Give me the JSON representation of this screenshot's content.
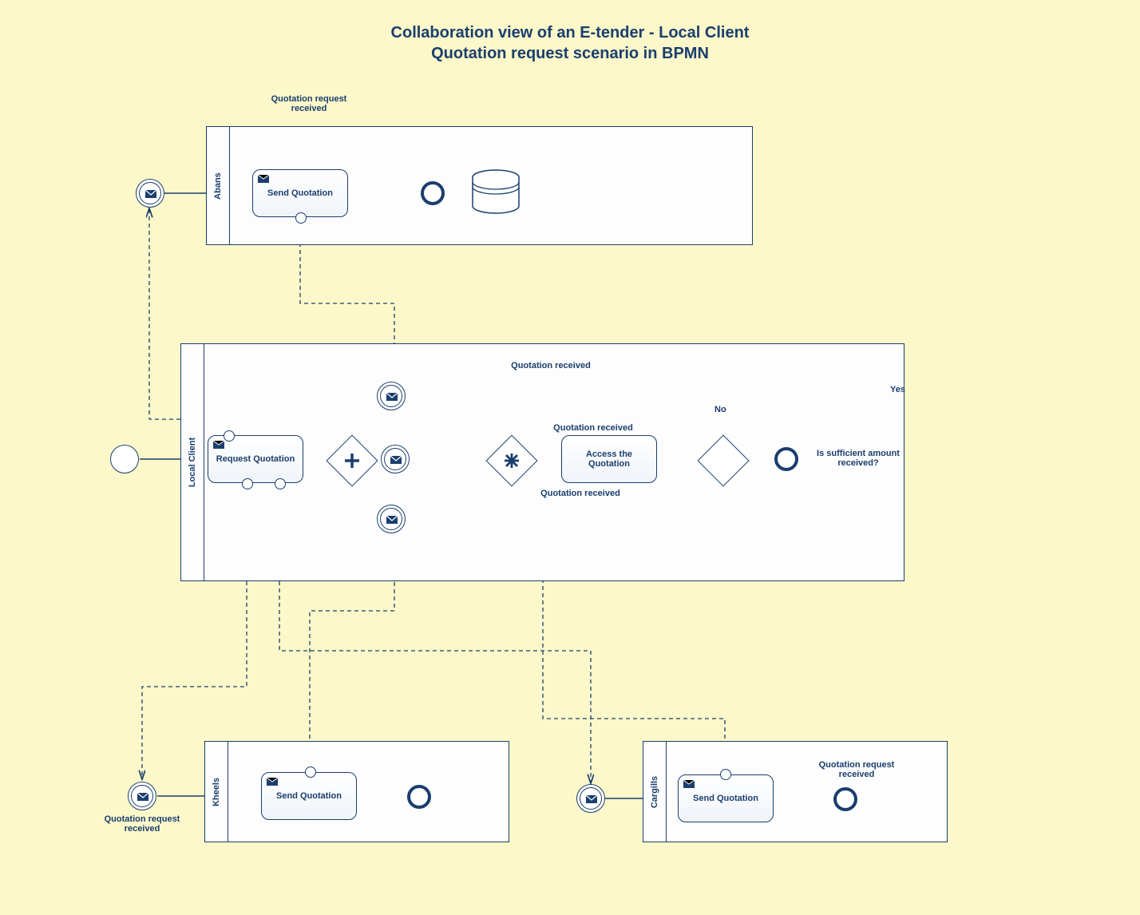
{
  "title_line1": "Collaboration view of an E-tender - Local Client",
  "title_line2": "Quotation request scenario in BPMN",
  "pools": {
    "abans": "Abans",
    "localClient": "Local Client",
    "kheels": "Kheels",
    "cargills": "Cargills"
  },
  "tasks": {
    "sendQuotationAbans": "Send Quotation",
    "requestQuotation": "Request Quotation",
    "accessQuotation": "Access the Quotation",
    "sendQuotationKheels": "Send Quotation",
    "sendQuotationCargills": "Send Quotation"
  },
  "labels": {
    "quotationRequestReceivedTop": "Quotation request received",
    "quotationReceived1": "Quotation received",
    "quotationReceived2": "Quotation received",
    "quotationReceived3": "Quotation received",
    "isSufficient": "Is sufficient amount received?",
    "yes": "Yes",
    "no": "No",
    "quotationRequestReceivedKheels": "Quotation request received",
    "quotationRequestReceivedCargills": "Quotation request received"
  }
}
